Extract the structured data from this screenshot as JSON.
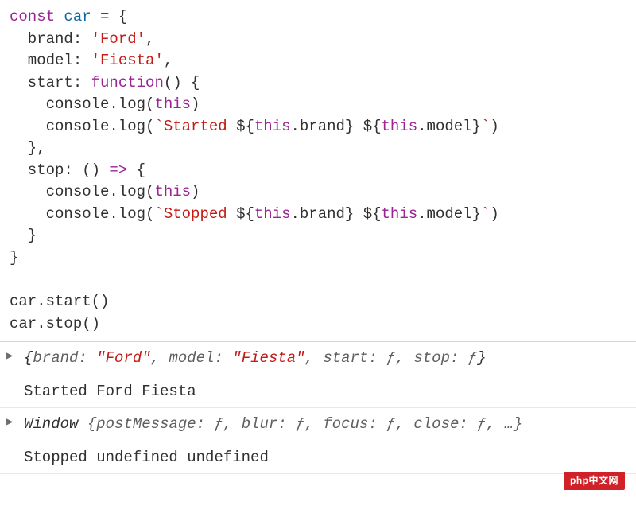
{
  "code": {
    "k_const": "const",
    "v_car": "car",
    "eq_open": " = {",
    "l_brand": "  brand: ",
    "s_ford": "'Ford'",
    "comma": ",",
    "l_model": "  model: ",
    "s_fiesta": "'Fiesta'",
    "l_start": "  start: ",
    "k_function": "function",
    "fn_open": "() {",
    "l_log": "    console.log(",
    "k_this": "this",
    "close_paren": ")",
    "s_started": "`Started ",
    "dollar_open": "${",
    "t_brand": ".brand",
    "close_brace": "}",
    "space": " ",
    "t_model": ".model",
    "s_tick_close": "`",
    "l_close_brace_comma": "  },",
    "l_stop": "  stop: () ",
    "arrow": "=>",
    "arrow_open": " {",
    "s_stopped": "`Stopped ",
    "l_close_brace": "  }",
    "obj_close": "}",
    "blank": "",
    "call_start": "car.start()",
    "call_stop": "car.stop()"
  },
  "console": {
    "obj1": {
      "open": "{",
      "k_brand": "brand: ",
      "v_brand": "\"Ford\"",
      "sep": ", ",
      "k_model": "model: ",
      "v_model": "\"Fiesta\"",
      "k_start": "start: ",
      "v_f": "ƒ",
      "k_stop": "stop: ",
      "close": "}"
    },
    "started": "Started Ford Fiesta",
    "window": {
      "name": "Window ",
      "open": "{",
      "k_pm": "postMessage: ",
      "v_f": "ƒ",
      "sep": ", ",
      "k_blur": "blur: ",
      "k_focus": "focus: ",
      "k_close": "close: ",
      "trail": ", …}",
      "cont": ""
    },
    "stopped": "Stopped undefined undefined"
  },
  "logo": "php中文网"
}
